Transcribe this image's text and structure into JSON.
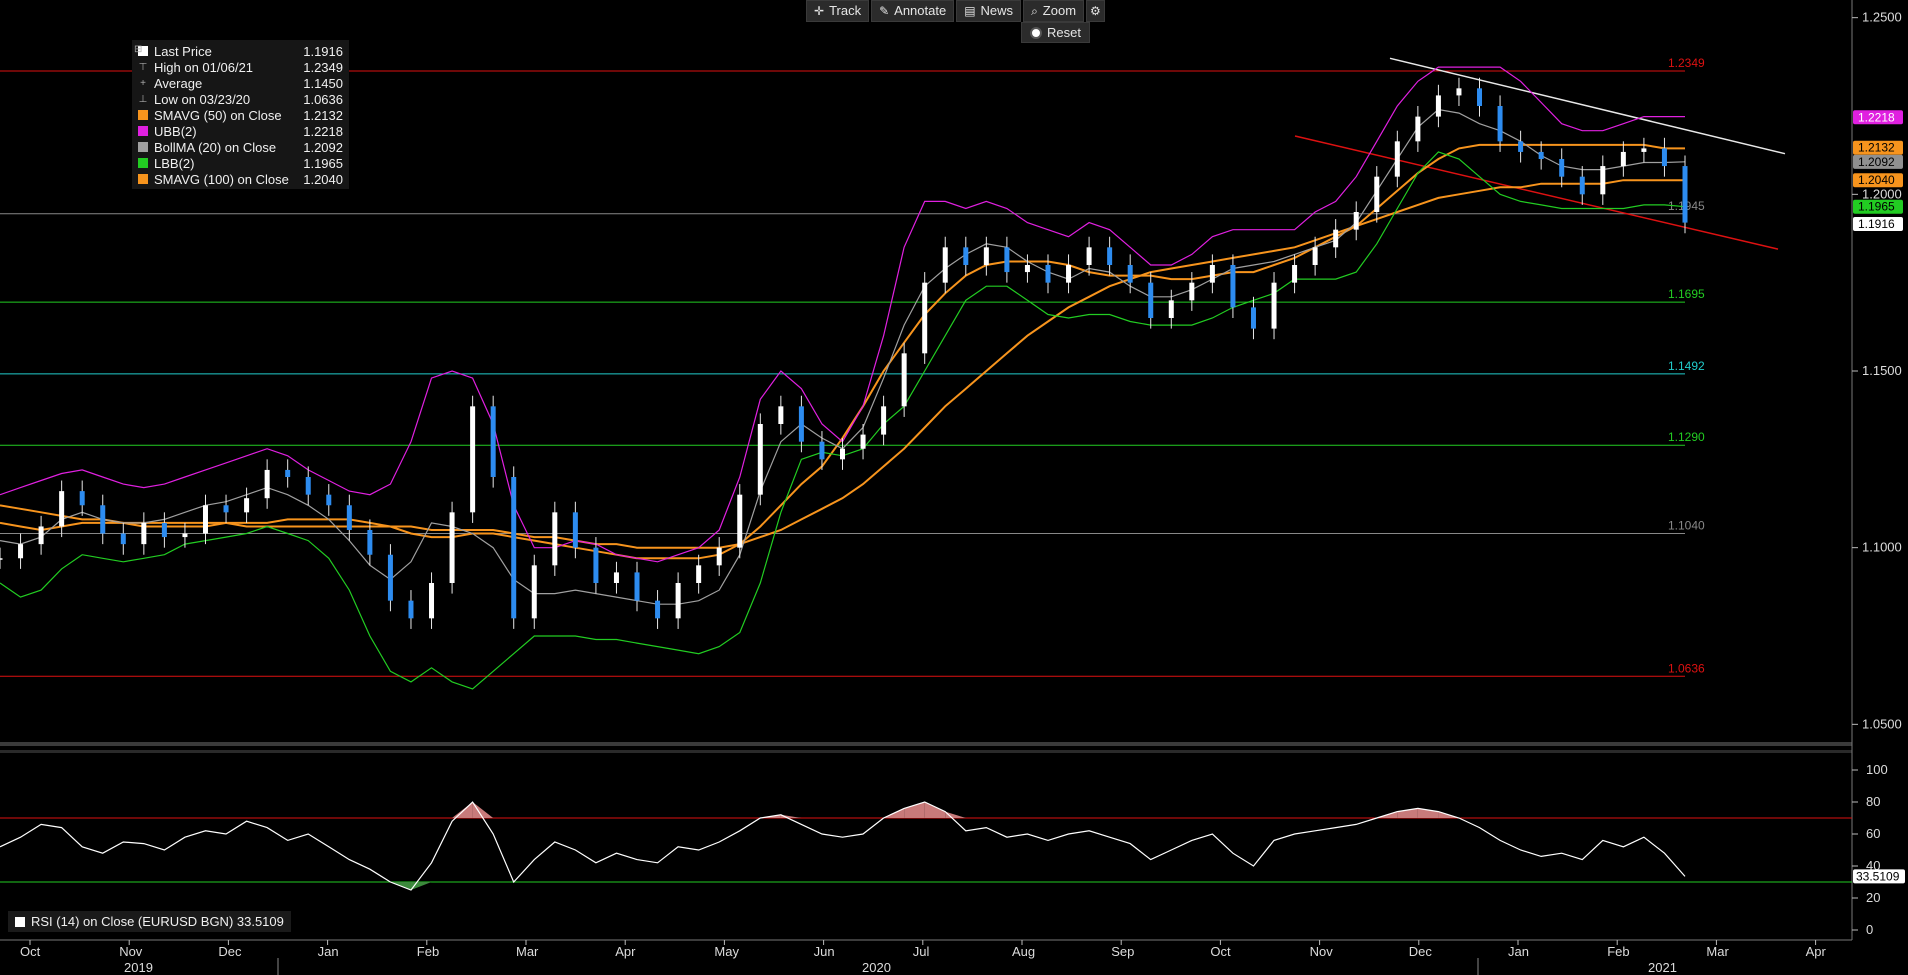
{
  "toolbar": {
    "track": "Track",
    "annotate": "Annotate",
    "news": "News",
    "zoom": "Zoom",
    "reset": "Reset"
  },
  "legend": [
    {
      "label": "Last Price",
      "value": "1.1916",
      "color": "#ffffff",
      "icon": "square"
    },
    {
      "label": "High on 01/06/21",
      "value": "1.2349",
      "color": "#aaaaaa",
      "icon": "high-marker"
    },
    {
      "label": "Average",
      "value": "1.1450",
      "color": "#aaaaaa",
      "icon": "average-marker"
    },
    {
      "label": "Low on 03/23/20",
      "value": "1.0636",
      "color": "#aaaaaa",
      "icon": "low-marker"
    },
    {
      "label": "SMAVG (50)  on Close",
      "value": "1.2132",
      "color": "#f7941d",
      "icon": "square"
    },
    {
      "label": "UBB(2)",
      "value": "1.2218",
      "color": "#e020e0",
      "icon": "square"
    },
    {
      "label": "BollMA (20)  on Close",
      "value": "1.2092",
      "color": "#a0a0a0",
      "icon": "square"
    },
    {
      "label": "LBB(2)",
      "value": "1.1965",
      "color": "#22cc22",
      "icon": "square"
    },
    {
      "label": "SMAVG (100)  on Close",
      "value": "1.2040",
      "color": "#f7941d",
      "icon": "square"
    }
  ],
  "rsi_legend": {
    "label": "RSI (14)  on Close (EURUSD BGN) 33.5109"
  },
  "chart_data": [
    {
      "type": "line",
      "title": "",
      "price_axis": {
        "ticks": [
          1.05,
          1.1,
          1.15,
          1.2,
          1.25
        ],
        "tick_labels": [
          "1.0500",
          "1.1000",
          "1.1500",
          "1.2000",
          "1.2500"
        ],
        "ylim": [
          1.045,
          1.255
        ]
      },
      "x_axis": {
        "months": [
          "Oct",
          "Nov",
          "Dec",
          "Jan",
          "Feb",
          "Mar",
          "Apr",
          "May",
          "Jun",
          "Jul",
          "Aug",
          "Sep",
          "Oct",
          "Nov",
          "Dec",
          "Jan",
          "Feb",
          "Mar",
          "Apr"
        ],
        "years": [
          "2019",
          "2020",
          "2021"
        ]
      },
      "horizontal_levels": [
        {
          "value": 1.2349,
          "label": "1.2349",
          "color": "#dd1111"
        },
        {
          "value": 1.1945,
          "label": "1.1945",
          "color": "#888888"
        },
        {
          "value": 1.1695,
          "label": "1.1695",
          "color": "#22cc22"
        },
        {
          "value": 1.1492,
          "label": "1.1492",
          "color": "#22cccc"
        },
        {
          "value": 1.129,
          "label": "1.1290",
          "color": "#22cc22"
        },
        {
          "value": 1.104,
          "label": "1.1040",
          "color": "#888888"
        },
        {
          "value": 1.0636,
          "label": "1.0636",
          "color": "#dd1111"
        }
      ],
      "last_value_tags": [
        {
          "value": 1.2218,
          "label": "1.2218",
          "bg": "#e020e0",
          "fg": "#ffffff"
        },
        {
          "value": 1.2132,
          "label": "1.2132",
          "bg": "#f7941d",
          "fg": "#000000"
        },
        {
          "value": 1.2092,
          "label": "1.2092",
          "bg": "#909090",
          "fg": "#000000"
        },
        {
          "value": 1.204,
          "label": "1.2040",
          "bg": "#f7941d",
          "fg": "#000000"
        },
        {
          "value": 1.1965,
          "label": "1.1965",
          "bg": "#22cc22",
          "fg": "#000000"
        },
        {
          "value": 1.1916,
          "label": "1.1916",
          "bg": "#ffffff",
          "fg": "#000000"
        }
      ],
      "series": [
        {
          "name": "Last Price",
          "color": "#2d8cf0",
          "y": [
            1.097,
            1.101,
            1.106,
            1.116,
            1.112,
            1.104,
            1.101,
            1.107,
            1.103,
            1.104,
            1.112,
            1.11,
            1.114,
            1.122,
            1.12,
            1.115,
            1.112,
            1.105,
            1.098,
            1.085,
            1.08,
            1.09,
            1.11,
            1.14,
            1.12,
            1.08,
            1.095,
            1.11,
            1.1,
            1.09,
            1.093,
            1.085,
            1.08,
            1.09,
            1.095,
            1.1,
            1.115,
            1.135,
            1.14,
            1.13,
            1.125,
            1.128,
            1.132,
            1.14,
            1.155,
            1.175,
            1.185,
            1.18,
            1.185,
            1.178,
            1.18,
            1.175,
            1.18,
            1.185,
            1.18,
            1.175,
            1.165,
            1.17,
            1.175,
            1.18,
            1.168,
            1.162,
            1.175,
            1.18,
            1.185,
            1.19,
            1.195,
            1.205,
            1.215,
            1.222,
            1.228,
            1.23,
            1.225,
            1.215,
            1.212,
            1.21,
            1.205,
            1.2,
            1.208,
            1.212,
            1.213,
            1.208,
            1.192
          ]
        },
        {
          "name": "SMAVG (50)",
          "color": "#f7941d",
          "y": [
            1.107,
            1.106,
            1.105,
            1.106,
            1.107,
            1.107,
            1.107,
            1.106,
            1.106,
            1.106,
            1.106,
            1.107,
            1.107,
            1.107,
            1.108,
            1.108,
            1.108,
            1.108,
            1.107,
            1.106,
            1.104,
            1.103,
            1.103,
            1.104,
            1.104,
            1.103,
            1.102,
            1.101,
            1.1,
            1.099,
            1.098,
            1.097,
            1.097,
            1.097,
            1.097,
            1.098,
            1.101,
            1.106,
            1.112,
            1.118,
            1.123,
            1.131,
            1.14,
            1.15,
            1.158,
            1.166,
            1.172,
            1.177,
            1.18,
            1.181,
            1.181,
            1.181,
            1.18,
            1.178,
            1.177,
            1.177,
            1.177,
            1.176,
            1.176,
            1.177,
            1.178,
            1.178,
            1.18,
            1.182,
            1.185,
            1.188,
            1.191,
            1.196,
            1.201,
            1.206,
            1.21,
            1.213,
            1.214,
            1.214,
            1.214,
            1.214,
            1.214,
            1.214,
            1.214,
            1.214,
            1.214,
            1.213,
            1.213
          ]
        },
        {
          "name": "SMAVG (100)",
          "color": "#f7941d",
          "y": [
            1.112,
            1.111,
            1.11,
            1.109,
            1.108,
            1.108,
            1.107,
            1.107,
            1.107,
            1.107,
            1.107,
            1.107,
            1.106,
            1.106,
            1.106,
            1.106,
            1.106,
            1.106,
            1.106,
            1.106,
            1.106,
            1.105,
            1.105,
            1.105,
            1.105,
            1.104,
            1.103,
            1.103,
            1.102,
            1.101,
            1.101,
            1.1,
            1.1,
            1.1,
            1.1,
            1.1,
            1.101,
            1.103,
            1.105,
            1.108,
            1.111,
            1.114,
            1.118,
            1.123,
            1.128,
            1.134,
            1.14,
            1.145,
            1.15,
            1.155,
            1.16,
            1.164,
            1.168,
            1.171,
            1.174,
            1.176,
            1.178,
            1.179,
            1.18,
            1.181,
            1.182,
            1.183,
            1.184,
            1.185,
            1.187,
            1.189,
            1.191,
            1.193,
            1.195,
            1.197,
            1.199,
            1.2,
            1.201,
            1.202,
            1.202,
            1.203,
            1.203,
            1.203,
            1.203,
            1.204,
            1.204,
            1.204,
            1.204
          ]
        },
        {
          "name": "UBB(2)",
          "color": "#e020e0",
          "y": [
            1.115,
            1.117,
            1.119,
            1.121,
            1.122,
            1.12,
            1.118,
            1.117,
            1.118,
            1.12,
            1.122,
            1.124,
            1.126,
            1.128,
            1.126,
            1.122,
            1.119,
            1.116,
            1.115,
            1.118,
            1.13,
            1.148,
            1.15,
            1.148,
            1.135,
            1.112,
            1.1,
            1.1,
            1.102,
            1.101,
            1.098,
            1.097,
            1.096,
            1.098,
            1.1,
            1.105,
            1.12,
            1.142,
            1.15,
            1.145,
            1.135,
            1.13,
            1.14,
            1.16,
            1.185,
            1.198,
            1.198,
            1.196,
            1.198,
            1.196,
            1.192,
            1.19,
            1.188,
            1.192,
            1.19,
            1.185,
            1.18,
            1.18,
            1.183,
            1.188,
            1.19,
            1.19,
            1.19,
            1.19,
            1.195,
            1.198,
            1.205,
            1.215,
            1.225,
            1.232,
            1.236,
            1.236,
            1.236,
            1.236,
            1.232,
            1.226,
            1.22,
            1.218,
            1.218,
            1.22,
            1.222,
            1.222,
            1.222
          ]
        },
        {
          "name": "LBB(2)",
          "color": "#22cc22",
          "y": [
            1.09,
            1.086,
            1.088,
            1.094,
            1.098,
            1.097,
            1.096,
            1.097,
            1.098,
            1.101,
            1.102,
            1.103,
            1.104,
            1.106,
            1.104,
            1.102,
            1.097,
            1.088,
            1.075,
            1.065,
            1.062,
            1.066,
            1.062,
            1.06,
            1.065,
            1.07,
            1.075,
            1.075,
            1.075,
            1.074,
            1.074,
            1.073,
            1.072,
            1.071,
            1.07,
            1.072,
            1.076,
            1.09,
            1.11,
            1.125,
            1.127,
            1.126,
            1.128,
            1.135,
            1.14,
            1.15,
            1.16,
            1.17,
            1.174,
            1.174,
            1.17,
            1.166,
            1.165,
            1.166,
            1.166,
            1.164,
            1.163,
            1.163,
            1.163,
            1.165,
            1.168,
            1.17,
            1.172,
            1.176,
            1.176,
            1.176,
            1.178,
            1.186,
            1.196,
            1.206,
            1.212,
            1.21,
            1.205,
            1.2,
            1.198,
            1.197,
            1.196,
            1.196,
            1.196,
            1.196,
            1.197,
            1.197,
            1.1965
          ]
        },
        {
          "name": "BollMA (20)",
          "color": "#a0a0a0",
          "y": [
            1.102,
            1.101,
            1.103,
            1.108,
            1.11,
            1.108,
            1.107,
            1.107,
            1.108,
            1.11,
            1.112,
            1.113,
            1.115,
            1.117,
            1.115,
            1.112,
            1.108,
            1.102,
            1.095,
            1.091,
            1.096,
            1.107,
            1.106,
            1.104,
            1.1,
            1.091,
            1.087,
            1.087,
            1.088,
            1.087,
            1.086,
            1.085,
            1.084,
            1.084,
            1.085,
            1.088,
            1.098,
            1.116,
            1.13,
            1.135,
            1.131,
            1.128,
            1.134,
            1.148,
            1.163,
            1.174,
            1.179,
            1.183,
            1.186,
            1.185,
            1.181,
            1.178,
            1.176,
            1.179,
            1.178,
            1.174,
            1.171,
            1.171,
            1.173,
            1.176,
            1.179,
            1.18,
            1.181,
            1.183,
            1.185,
            1.187,
            1.192,
            1.201,
            1.21,
            1.219,
            1.224,
            1.223,
            1.22,
            1.218,
            1.215,
            1.211,
            1.208,
            1.207,
            1.207,
            1.208,
            1.209,
            1.209,
            1.2092
          ]
        }
      ]
    },
    {
      "type": "line",
      "title": "",
      "ylim": [
        0,
        100
      ],
      "ticks": [
        0,
        20,
        40,
        60,
        80,
        100
      ],
      "overbought": 70,
      "oversold": 30,
      "last_label": "33.5109",
      "series": [
        {
          "name": "RSI (14)",
          "color": "#ffffff",
          "y": [
            52,
            58,
            66,
            64,
            52,
            48,
            55,
            54,
            50,
            58,
            62,
            60,
            68,
            64,
            56,
            60,
            52,
            44,
            38,
            30,
            25,
            42,
            68,
            80,
            60,
            30,
            44,
            55,
            50,
            42,
            48,
            44,
            42,
            52,
            50,
            55,
            62,
            70,
            72,
            66,
            60,
            58,
            60,
            70,
            76,
            80,
            74,
            62,
            64,
            58,
            60,
            56,
            60,
            62,
            58,
            54,
            44,
            50,
            56,
            60,
            48,
            40,
            56,
            60,
            62,
            64,
            66,
            70,
            74,
            76,
            74,
            70,
            64,
            56,
            50,
            46,
            48,
            44,
            56,
            52,
            58,
            48,
            33.5
          ]
        }
      ]
    }
  ]
}
